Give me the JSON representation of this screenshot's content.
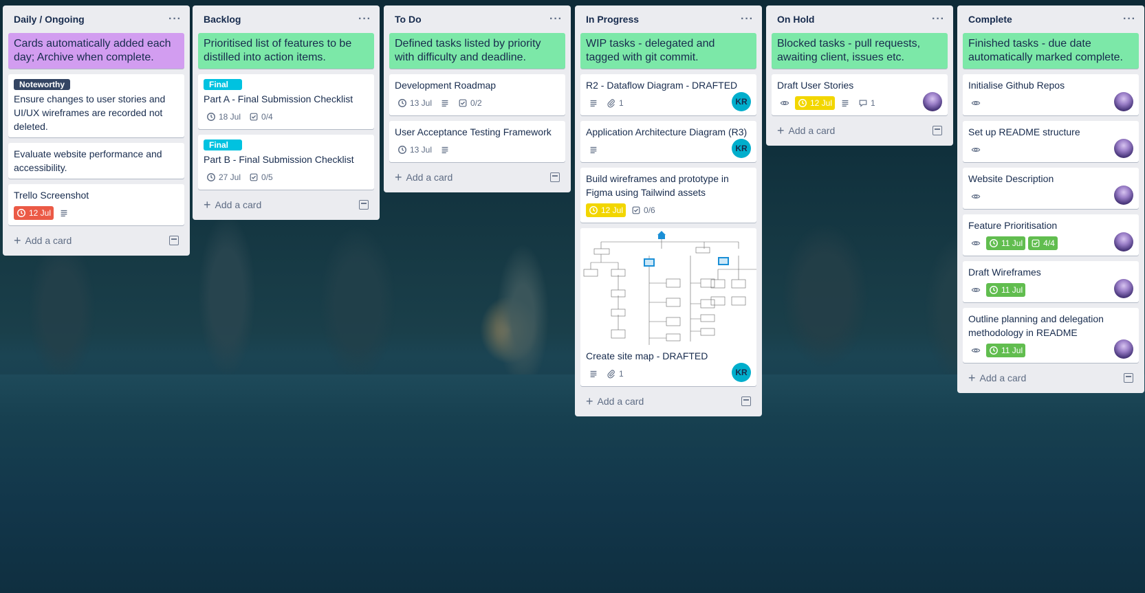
{
  "lists": [
    {
      "title": "Daily / Ongoing",
      "menu": "···",
      "add": "Add a card",
      "cards": [
        {
          "type": "colored",
          "color": "#d29df0",
          "text": "Cards automatically added each day; Archive when complete."
        },
        {
          "label": "Noteworthy",
          "title": "Ensure changes to user stories and UI/UX wireframes are recorded not deleted."
        },
        {
          "title": "Evaluate website performance and accessibility."
        },
        {
          "title": "Trello Screenshot",
          "due": "12 Jul",
          "due_status": "overdue",
          "description_icon": "description-icon"
        }
      ]
    },
    {
      "title": "Backlog",
      "menu": "···",
      "add": "Add a card",
      "cards": [
        {
          "type": "colored",
          "color": "#7ce8a8",
          "text": "Prioritised list of features to be distilled into action items."
        },
        {
          "label": "Final",
          "title": "Part A - Final Submission Checklist",
          "date": "18 Jul",
          "checklist": "0/4"
        },
        {
          "label": "Final",
          "title": "Part B - Final Submission Checklist",
          "date": "27 Jul",
          "checklist": "0/5"
        }
      ]
    },
    {
      "title": "To Do",
      "menu": "···",
      "add": "Add a card",
      "cards": [
        {
          "type": "colored",
          "color": "#7ce8a8",
          "text": "Defined tasks listed by priority with difficulty and deadline."
        },
        {
          "title": "Development Roadmap",
          "date": "13 Jul",
          "checklist": "0/2"
        },
        {
          "title": "User Acceptance Testing Framework",
          "date": "13 Jul"
        }
      ]
    },
    {
      "title": "In Progress",
      "menu": "···",
      "add": "Add a card",
      "cards": [
        {
          "type": "colored",
          "color": "#7ce8a8",
          "text": "WIP tasks - delegated and tagged with git commit."
        },
        {
          "title": "R2 - Dataflow Diagram - DRAFTED",
          "attachments": "1",
          "member": "KR"
        },
        {
          "title": "Application Architecture Diagram (R3)",
          "member": "KR"
        },
        {
          "title": "Build wireframes and prototype in Figma using Tailwind assets",
          "due": "12 Jul",
          "due_status": "due-soon",
          "checklist": "0/6"
        },
        {
          "title": "Create site map - DRAFTED",
          "attachments": "1",
          "member": "KR"
        }
      ]
    },
    {
      "title": "On Hold",
      "menu": "···",
      "add": "Add a card",
      "cards": [
        {
          "type": "colored",
          "color": "#7ce8a8",
          "text": "Blocked tasks - pull requests, awaiting client, issues etc."
        },
        {
          "title": "Draft User Stories",
          "due": "12 Jul",
          "due_status": "due-soon",
          "comments": "1"
        }
      ]
    },
    {
      "title": "Complete",
      "menu": "···",
      "add": "Add a card",
      "cards": [
        {
          "type": "colored",
          "color": "#7ce8a8",
          "text": "Finished tasks - due date automatically marked complete."
        },
        {
          "title": "Initialise Github Repos"
        },
        {
          "title": "Set up README structure"
        },
        {
          "title": "Website Description"
        },
        {
          "title": "Feature Prioritisation",
          "due": "11 Jul",
          "due_status": "complete",
          "checklist": "4/4"
        },
        {
          "title": "Draft Wireframes",
          "due": "11 Jul",
          "due_status": "complete"
        },
        {
          "title": "Outline planning and delegation methodology in README",
          "due": "11 Jul",
          "due_status": "complete"
        }
      ]
    }
  ]
}
